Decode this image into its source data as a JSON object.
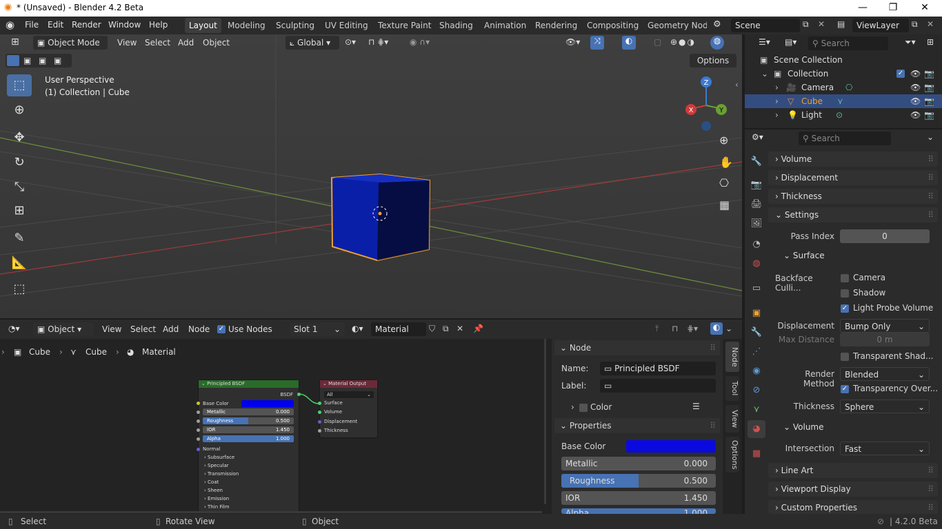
{
  "window": {
    "title": "* (Unsaved) - Blender 4.2 Beta",
    "minimize": "—",
    "maximize": "❐",
    "close": "✕"
  },
  "menu": {
    "items": [
      "File",
      "Edit",
      "Render",
      "Window",
      "Help"
    ]
  },
  "workspaces": [
    "Layout",
    "Modeling",
    "Sculpting",
    "UV Editing",
    "Texture Paint",
    "Shading",
    "Animation",
    "Rendering",
    "Compositing",
    "Geometry Node"
  ],
  "scene": {
    "name": "Scene",
    "view_layer": "ViewLayer"
  },
  "viewport": {
    "mode": "Object Mode",
    "menus": [
      "View",
      "Select",
      "Add",
      "Object"
    ],
    "orientation": "Global",
    "options": "Options",
    "perspective": "User Perspective",
    "context": "(1) Collection | Cube",
    "gizmo": {
      "x": "X",
      "y": "Y",
      "z": "Z"
    },
    "colors": {
      "cube": "#0a1fa8",
      "outline": "#f0a030"
    }
  },
  "outliner": {
    "search_placeholder": "Search",
    "scene_collection": "Scene Collection",
    "collection": "Collection",
    "items": [
      "Camera",
      "Cube",
      "Light"
    ]
  },
  "properties": {
    "search_placeholder": "Search",
    "panels": {
      "volume": "Volume",
      "displacement": "Displacement",
      "thickness": "Thickness",
      "settings": "Settings",
      "surface": "Surface",
      "volume_sub": "Volume",
      "line_art": "Line Art",
      "viewport_display": "Viewport Display",
      "custom_properties": "Custom Properties"
    },
    "pass_index_label": "Pass Index",
    "pass_index": "0",
    "backface_label": "Backface Culli...",
    "cb_camera": "Camera",
    "cb_shadow": "Shadow",
    "cb_light_probe": "Light Probe Volume",
    "displacement_label": "Displacement",
    "displacement_value": "Bump Only",
    "max_distance_label": "Max Distance",
    "max_distance": "0 m",
    "transparent_shadows": "Transparent Shad...",
    "render_method_label": "Render Method",
    "render_method": "Blended",
    "transparency_overlap": "Transparency Over...",
    "thickness_label": "Thickness",
    "thickness_value": "Sphere",
    "intersection_label": "Intersection",
    "intersection_value": "Fast"
  },
  "node_header": {
    "editor_type": "Object",
    "menus": [
      "View",
      "Select",
      "Add",
      "Node"
    ],
    "use_nodes": "Use Nodes",
    "slot": "Slot 1",
    "material": "Material"
  },
  "breadcrumb": [
    "Cube",
    "Cube",
    "Material"
  ],
  "principled": {
    "title": "Principled BSDF",
    "output": "BSDF",
    "base_color_label": "Base Color",
    "metallic_label": "Metallic",
    "metallic": "0.000",
    "roughness_label": "Roughness",
    "roughness": "0.500",
    "ior_label": "IOR",
    "ior": "1.450",
    "alpha_label": "Alpha",
    "alpha": "1.000",
    "normal": "Normal",
    "sections": [
      "Subsurface",
      "Specular",
      "Transmission",
      "Coat",
      "Sheen",
      "Emission",
      "Thin Film"
    ],
    "roughness_fraction": 0.5
  },
  "material_output": {
    "title": "Material Output",
    "target": "All",
    "inputs": [
      "Surface",
      "Volume",
      "Displacement",
      "Thickness"
    ]
  },
  "npanel": {
    "node_header": "Node",
    "name_label": "Name:",
    "name_value": "Principled BSDF",
    "label_label": "Label:",
    "color": "Color",
    "properties_header": "Properties",
    "base_color_label": "Base Color",
    "metallic_label": "Metallic",
    "metallic": "0.000",
    "roughness_label": "Roughness",
    "roughness": "0.500",
    "ior_label": "IOR",
    "ior": "1.450",
    "alpha_label": "Alpha",
    "alpha": "1.000",
    "tabs": [
      "Node",
      "Tool",
      "View",
      "Options"
    ]
  },
  "status": {
    "select": "Select",
    "rotate": "Rotate View",
    "object": "Object",
    "version": "4.2.0 Beta"
  }
}
